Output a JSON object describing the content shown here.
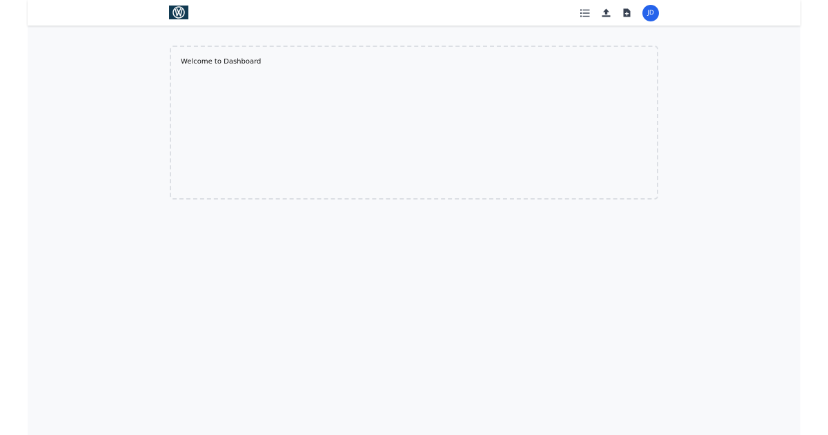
{
  "header": {
    "logo_icon": "vw-logo-icon",
    "actions": [
      {
        "icon": "list-icon"
      },
      {
        "icon": "upload-icon"
      },
      {
        "icon": "file-add-icon"
      }
    ],
    "avatar_initials": "JD"
  },
  "main": {
    "welcome_text": "Welcome to Dashboard"
  },
  "colors": {
    "header_bg": "#ffffff",
    "page_bg": "#f8f9fb",
    "logo_bg": "#113a52",
    "avatar_bg": "#2563eb",
    "icon_color": "#374151",
    "card_border": "#dcdfe4"
  }
}
